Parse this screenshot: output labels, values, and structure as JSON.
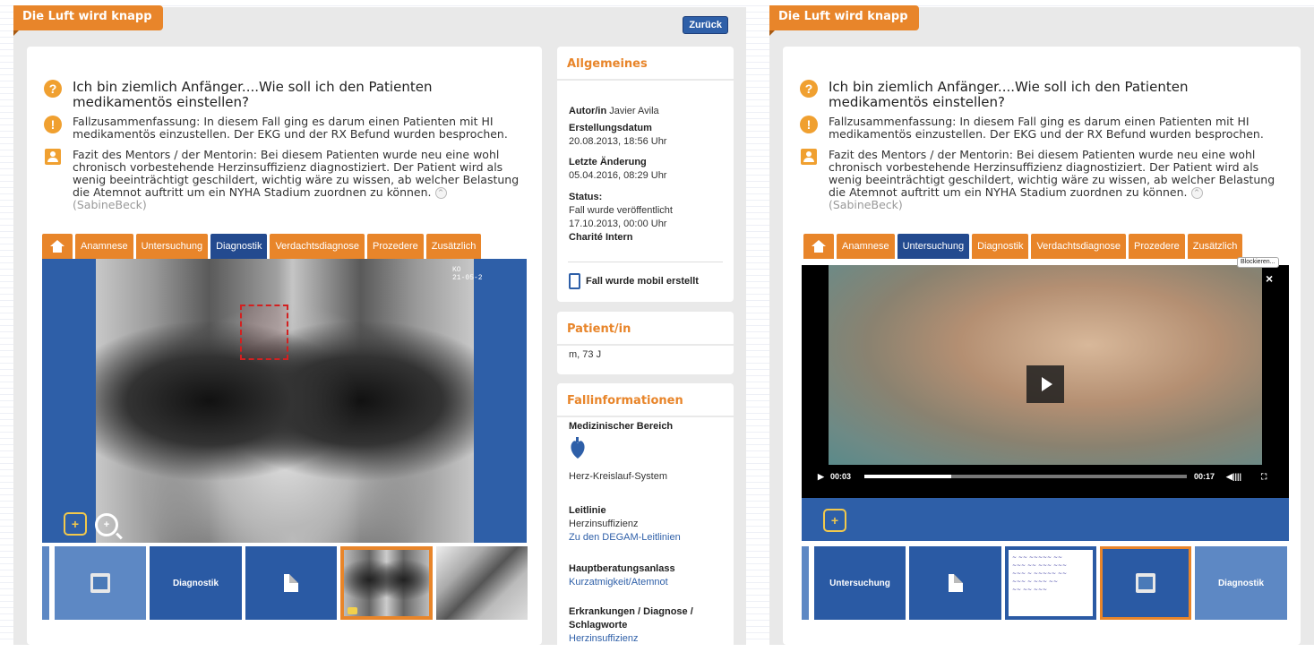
{
  "panel_title": "Die Luft wird knapp",
  "back_label": "Zurück",
  "question": "Ich bin ziemlich Anfänger....Wie soll ich den Patienten medikamentös einstellen?",
  "summary": "Fallzusammenfassung: In diesem Fall ging es darum einen Patienten mit HI medikamentös einzustellen. Der EKG und der RX Befund wurden besprochen.",
  "mentor_text": "Fazit des Mentors / der Mentorin: Bei diesem Patienten wurde neu eine wohl chronisch vorbestehende Herzinsuffizienz diagnostiziert. Der Patient wird als wenig beeinträchtigt geschildert, wichtig wäre zu wissen, ab welcher Belastung die Atemnot auftritt um ein NYHA Stadium zuordnen zu können.",
  "mentor_signature": "(SabineBeck)",
  "icons": {
    "question": "?",
    "summary": "!",
    "collapse": "^",
    "comment": "+",
    "zoom": "+",
    "close": "×",
    "play": "play-icon"
  },
  "tabs": [
    "Anamnese",
    "Untersuchung",
    "Diagnostik",
    "Verdachtsdiagnose",
    "Prozedere",
    "Zusätzlich"
  ],
  "left_active_tab": "Diagnostik",
  "right_active_tab": "Untersuchung",
  "xray_label_lines": [
    "KO",
    "21-05-2"
  ],
  "left_thumbs": [
    {
      "type": "video",
      "label": ""
    },
    {
      "type": "text",
      "label": "Diagnostik"
    },
    {
      "type": "doc",
      "label": ""
    },
    {
      "type": "xray",
      "label": "",
      "selected": true
    },
    {
      "type": "xray2",
      "label": ""
    }
  ],
  "right_thumbs": [
    {
      "type": "text",
      "label": "Untersuchung"
    },
    {
      "type": "doc",
      "label": ""
    },
    {
      "type": "handwritten",
      "label": ""
    },
    {
      "type": "video",
      "label": "",
      "selected": true
    },
    {
      "type": "text",
      "label": "Diagnostik"
    }
  ],
  "video": {
    "current_time": "00:03",
    "duration": "00:17",
    "progress": 0.27,
    "block_label": "Blockieren..."
  },
  "sidebar": {
    "general_title": "Allgemeines",
    "author_label": "Autor/in",
    "author_name": "Javier Avila",
    "created_label": "Erstellungsdatum",
    "created_value": "20.08.2013, 18:56 Uhr",
    "changed_label": "Letzte Änderung",
    "changed_value": "05.04.2016, 08:29 Uhr",
    "status_label": "Status:",
    "status_value": "Fall wurde veröffentlicht",
    "status_date": "17.10.2013, 00:00 Uhr",
    "status_link": "Charité Intern",
    "mobile_note": "Fall wurde mobil erstellt",
    "patient_title": "Patient/in",
    "patient_value": "m, 73 J",
    "case_title": "Fallinformationen",
    "med_label": "Medizinischer Bereich",
    "med_value": "Herz-Kreislauf-System",
    "guide_label": "Leitlinie",
    "guide_value": "Herzinsuffizienz",
    "guide_link": "Zu den DEGAM-Leitlinien",
    "reason_label": "Hauptberatungsanlass",
    "reason_link": "Kurzatmigkeit/Atemnot",
    "disease_label": "Erkrankungen / Diagnose / Schlagworte",
    "disease_link": "Herzinsuffizienz"
  },
  "colors": {
    "accent": "#e8852a",
    "brand_blue": "#234a8f",
    "link": "#2e5fa8"
  }
}
